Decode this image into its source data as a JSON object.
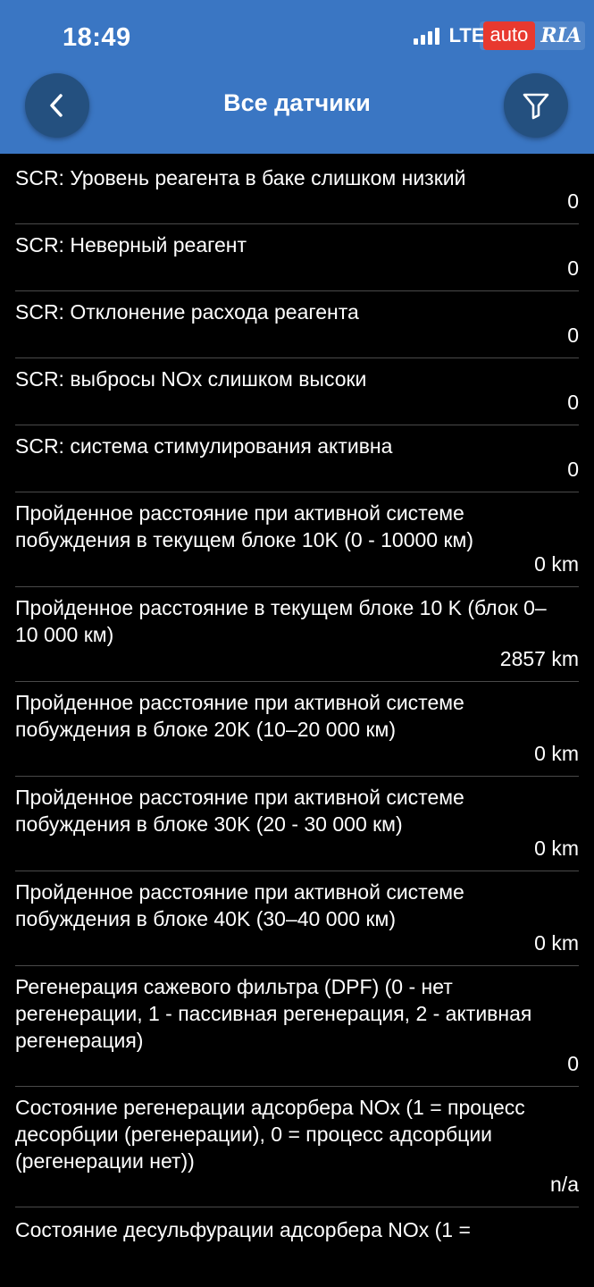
{
  "status_bar": {
    "time": "18:49",
    "network": "LTE",
    "watermark_auto": "auto",
    "watermark_ria": "RIA"
  },
  "header": {
    "title": "Все датчики",
    "back_icon": "chevron-left-icon",
    "filter_icon": "filter-icon",
    "background": "#3a76c3",
    "button_color": "#24507f"
  },
  "sensors": [
    {
      "label": "SCR: Уровень реагента в баке слишком низкий",
      "value": "0"
    },
    {
      "label": "SCR: Неверный реагент",
      "value": "0"
    },
    {
      "label": "SCR: Отклонение расхода реагента",
      "value": "0"
    },
    {
      "label": "SCR: выбросы NOx слишком высоки",
      "value": "0"
    },
    {
      "label": "SCR: система стимулирования активна",
      "value": "0"
    },
    {
      "label": "Пройденное расстояние при активной системе побуждения в текущем блоке 10K (0 - 10000 км)",
      "value": "0 km"
    },
    {
      "label": "Пройденное расстояние в текущем блоке 10 K (блок 0–10 000 км)",
      "value": "2857 km"
    },
    {
      "label": "Пройденное расстояние при активной системе побуждения в блоке 20K (10–20 000 км)",
      "value": "0 km"
    },
    {
      "label": "Пройденное расстояние при активной системе побуждения в блоке 30K (20 - 30 000 км)",
      "value": "0 km"
    },
    {
      "label": "Пройденное расстояние при активной системе побуждения в блоке 40K (30–40 000 км)",
      "value": "0 km"
    },
    {
      "label": "Регенерация сажевого фильтра (DPF) (0 - нет регенерации, 1 - пассивная регенерация, 2 - активная регенерация)",
      "value": "0"
    },
    {
      "label": "Состояние регенерации адсорбера NOx (1 = процесс десорбции (регенерации), 0 = процесс адсорбции (регенерации нет))",
      "value": "n/a"
    },
    {
      "label": "Состояние десульфурации адсорбера NOx (1 =",
      "value": ""
    }
  ]
}
